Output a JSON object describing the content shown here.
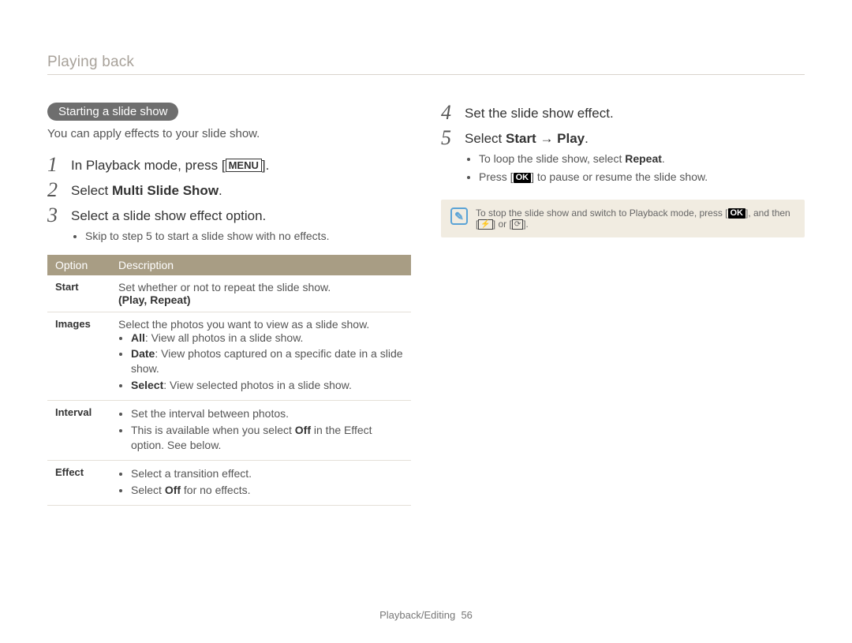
{
  "header": {
    "breadcrumb": "Playing back"
  },
  "left": {
    "pill": "Starting a slide show",
    "intro": "You can apply effects to your slide show.",
    "steps": [
      {
        "num": "1",
        "pre": "In Playback mode, press [",
        "menu": "MENU",
        "post": "]."
      },
      {
        "num": "2",
        "text_pre": "Select ",
        "bold": "Multi Slide Show",
        "text_post": "."
      },
      {
        "num": "3",
        "text": "Select a slide show effect option.",
        "bullet": "Skip to step 5 to start a slide show with no effects."
      }
    ],
    "table": {
      "head": {
        "c1": "Option",
        "c2": "Description"
      },
      "rows": [
        {
          "opt": "Start",
          "desc_line": "Set whether or not to repeat the slide show.",
          "desc_bold_paren": "(Play, Repeat)"
        },
        {
          "opt": "Images",
          "lead": "Select the photos you want to view as a slide show.",
          "bullets": [
            {
              "b": "All",
              "t": ": View all photos in a slide show."
            },
            {
              "b": "Date",
              "t": ": View photos captured on a specific date in a slide show."
            },
            {
              "b": "Select",
              "t": ": View selected photos in a slide show."
            }
          ]
        },
        {
          "opt": "Interval",
          "bullets_plain": [
            "Set the interval between photos.",
            "This is available when you select Off in the Effect option. See below."
          ],
          "bold_in_second": "Off"
        },
        {
          "opt": "Effect",
          "bullets_plain": [
            "Select a transition effect.",
            "Select Off for no effects."
          ],
          "bold_in_second": "Off"
        }
      ]
    }
  },
  "right": {
    "steps": [
      {
        "num": "4",
        "text": "Set the slide show effect."
      },
      {
        "num": "5",
        "pre": "Select ",
        "bold": "Start → Play",
        "post": ".",
        "bullets": [
          {
            "pre": "To loop the slide show, select ",
            "bold": "Repeat",
            "post": "."
          },
          {
            "pre": "Press [",
            "ok": "OK",
            "post": "] to pause or resume the slide show."
          }
        ]
      }
    ],
    "note": {
      "pre": "To stop the slide show and switch to Playback mode, press [",
      "ok": "OK",
      "mid": "], and then [",
      "g1": "⚡",
      "or": "] or [",
      "g2": "⟳",
      "end": "]."
    }
  },
  "footer": {
    "section": "Playback/Editing",
    "page": "56"
  }
}
